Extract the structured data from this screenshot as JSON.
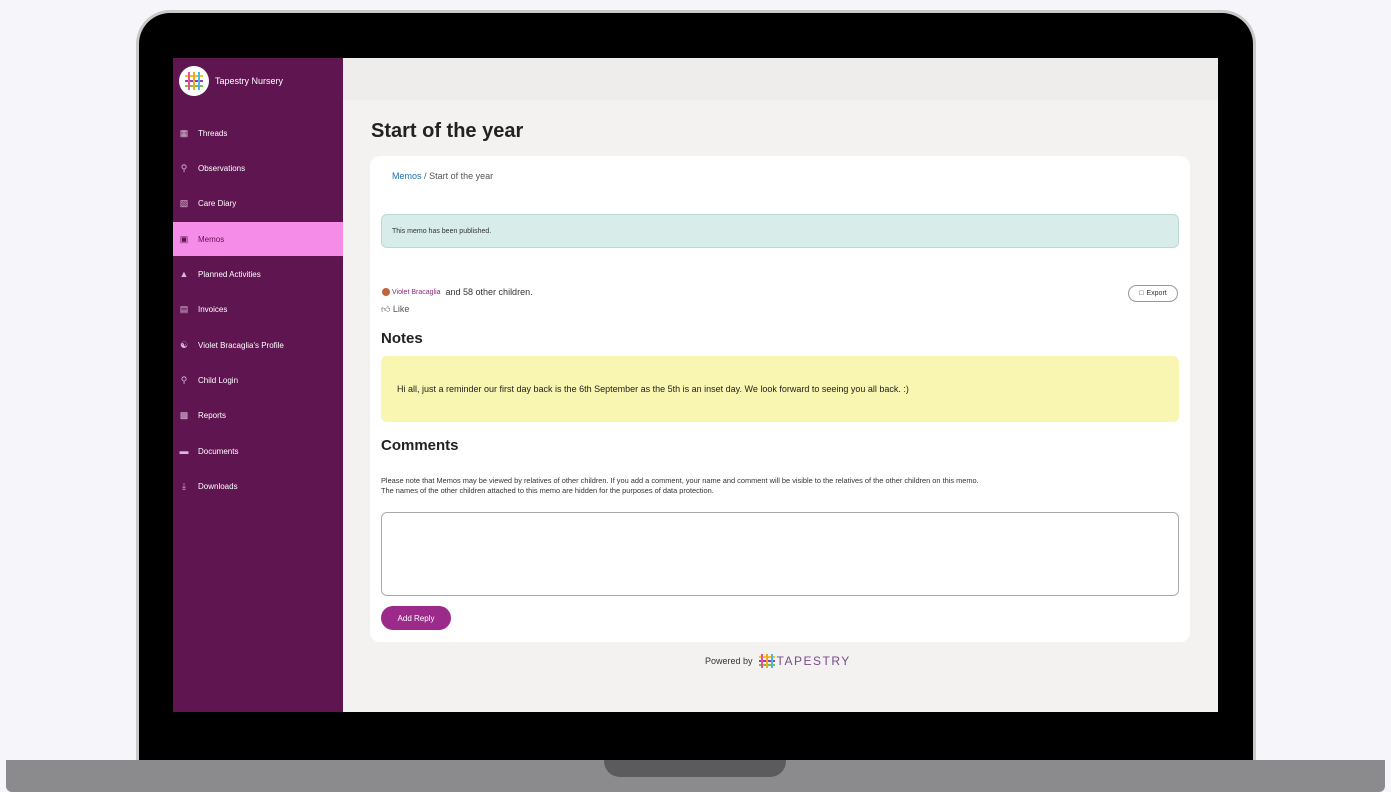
{
  "brand": {
    "name": "Tapestry Nursery"
  },
  "sidebar": {
    "items": [
      {
        "label": "Threads",
        "icon": "threads-icon"
      },
      {
        "label": "Observations",
        "icon": "observations-icon"
      },
      {
        "label": "Care Diary",
        "icon": "care-diary-icon"
      },
      {
        "label": "Memos",
        "icon": "memos-icon",
        "active": true
      },
      {
        "label": "Planned Activities",
        "icon": "planned-activities-icon"
      },
      {
        "label": "Invoices",
        "icon": "invoices-icon"
      },
      {
        "label": "Violet Bracaglia's Profile",
        "icon": "profile-icon"
      },
      {
        "label": "Child Login",
        "icon": "key-icon"
      },
      {
        "label": "Reports",
        "icon": "reports-icon"
      },
      {
        "label": "Documents",
        "icon": "folder-icon"
      },
      {
        "label": "Downloads",
        "icon": "download-icon"
      }
    ]
  },
  "page": {
    "title": "Start of the year"
  },
  "breadcrumb": {
    "parent": "Memos",
    "separator": "/",
    "current": "Start of the year"
  },
  "status": {
    "published": "This memo has been published."
  },
  "children": {
    "name": "Violet Bracaglia",
    "others": "and 58 other children."
  },
  "actions": {
    "export": "Export",
    "like": "Like"
  },
  "notes": {
    "heading": "Notes",
    "text": "Hi all, just a reminder our first day back is the 6th September as the 5th is an inset day. We look forward to seeing you all back. :)"
  },
  "comments": {
    "heading": "Comments",
    "note_line1": "Please note that Memos may be viewed by relatives of other children. If you add a comment, your name and comment will be visible to the relatives of the other children on this memo.",
    "note_line2": "The names of the other children attached to this memo are hidden for the purposes of data protection.",
    "reply_value": "",
    "add_reply": "Add Reply"
  },
  "footer": {
    "powered_by": "Powered by",
    "brand": "TAPESTRY"
  },
  "colors": {
    "sidebar": "#5f1550",
    "active_nav": "#f58ce8",
    "accent": "#9b2a8a",
    "notes_bg": "#f8f6b0",
    "published_bg": "#d8ece9"
  }
}
